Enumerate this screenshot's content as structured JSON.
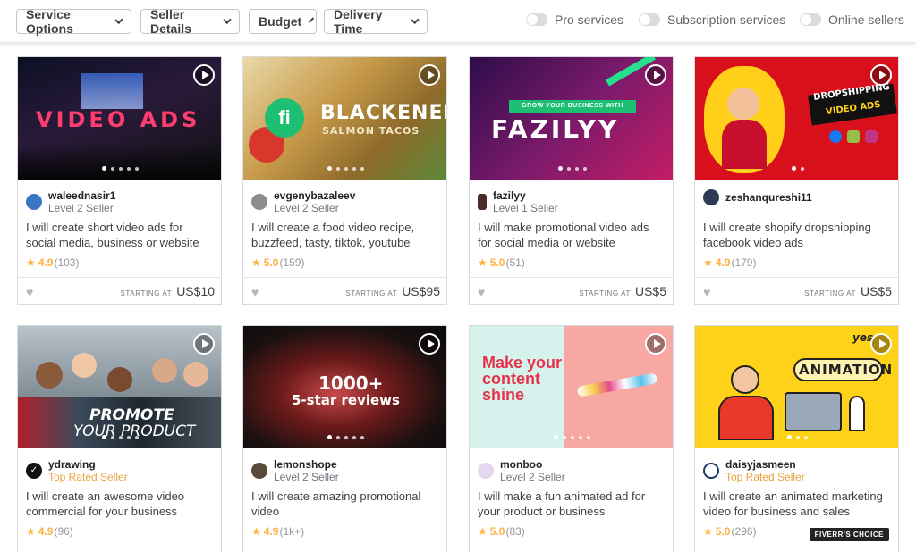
{
  "filters": {
    "dropdowns": [
      "Service Options",
      "Seller Details",
      "Budget",
      "Delivery Time"
    ],
    "toggles": [
      "Pro services",
      "Subscription services",
      "Online sellers"
    ]
  },
  "price_label": "STARTING AT",
  "gigs": [
    {
      "overlay": "VIDEO ADS",
      "seller": "waleednasir1",
      "level": "Level 2 Seller",
      "title": "I will create short video ads for social media, business or website",
      "rating": "4.9",
      "reviews": "(103)",
      "price": "US$10"
    },
    {
      "overlay": "BLACKENED",
      "overlay2": "SALMON TACOS",
      "badge": "fi",
      "seller": "evgenybazaleev",
      "level": "Level 2 Seller",
      "title": "I will create a food video recipe, buzzfeed, tasty, tiktok, youtube",
      "rating": "5.0",
      "reviews": "(159)",
      "price": "US$95"
    },
    {
      "overlay": "FAZILYY",
      "overlay2": "GROW YOUR BUSINESS WITH",
      "seller": "fazilyy",
      "level": "Level 1 Seller",
      "title": "I will make promotional video ads for social media or website",
      "rating": "5.0",
      "reviews": "(51)",
      "price": "US$5"
    },
    {
      "overlay": "DROPSHIPPING",
      "overlay2": "VIDEO ADS",
      "seller": "zeshanqureshi11",
      "level": "",
      "title": "I will create shopify dropshipping facebook video ads",
      "rating": "4.9",
      "reviews": "(179)",
      "price": "US$5"
    },
    {
      "overlay": "PROMOTE",
      "overlay2": "YOUR PRODUCT",
      "seller": "ydrawing",
      "level": "Top Rated Seller",
      "title": "I will create an awesome video commercial for your business",
      "rating": "4.9",
      "reviews": "(96)"
    },
    {
      "overlay": "1000+",
      "overlay2": "5-star reviews",
      "seller": "lemonshope",
      "level": "Level 2 Seller",
      "title": "I will create amazing promotional video",
      "rating": "4.9",
      "reviews": "(1k+)"
    },
    {
      "overlay": "Make your content shine",
      "seller": "monboo",
      "level": "Level 2 Seller",
      "title": "I will make a fun animated ad for your product or business",
      "rating": "5.0",
      "reviews": "(83)"
    },
    {
      "overlay": "ANIMATION",
      "overlay2": "yes",
      "seller": "daisyjasmeen",
      "level": "Top Rated Seller",
      "title": "I will create an animated marketing video for business and sales",
      "rating": "5.0",
      "reviews": "(296)",
      "badge": "FIVERR'S CHOICE"
    }
  ],
  "colors": {
    "star": "#ffb33e",
    "top_rated": "#e8a33d",
    "accent_green": "#1dbf73"
  }
}
